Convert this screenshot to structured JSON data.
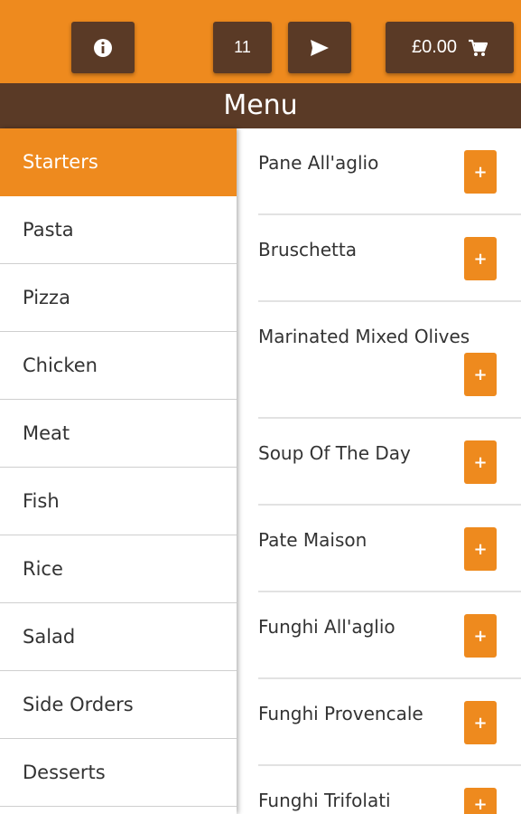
{
  "topbar": {
    "info_icon": "info-circle-icon",
    "table_number": "11",
    "send_icon": "send-arrow-icon",
    "cart_total": "£0.00",
    "cart_icon": "shopping-cart-icon",
    "accent_color": "#ee8a1e",
    "dark_color": "#5a3a26"
  },
  "title": "Menu",
  "categories": [
    {
      "label": "Starters",
      "active": true
    },
    {
      "label": "Pasta"
    },
    {
      "label": "Pizza"
    },
    {
      "label": "Chicken"
    },
    {
      "label": "Meat"
    },
    {
      "label": "Fish"
    },
    {
      "label": "Rice"
    },
    {
      "label": "Salad"
    },
    {
      "label": "Side Orders"
    },
    {
      "label": "Desserts"
    }
  ],
  "items": [
    {
      "name": "Pane All'aglio",
      "add_label": "+"
    },
    {
      "name": "Bruschetta",
      "add_label": "+"
    },
    {
      "name": "Marinated Mixed Olives",
      "add_label": "+"
    },
    {
      "name": "Soup Of The Day",
      "add_label": "+"
    },
    {
      "name": "Pate Maison",
      "add_label": "+"
    },
    {
      "name": "Funghi All'aglio",
      "add_label": "+"
    },
    {
      "name": "Funghi Provencale",
      "add_label": "+"
    },
    {
      "name": "Funghi Trifolati",
      "add_label": "+"
    }
  ]
}
